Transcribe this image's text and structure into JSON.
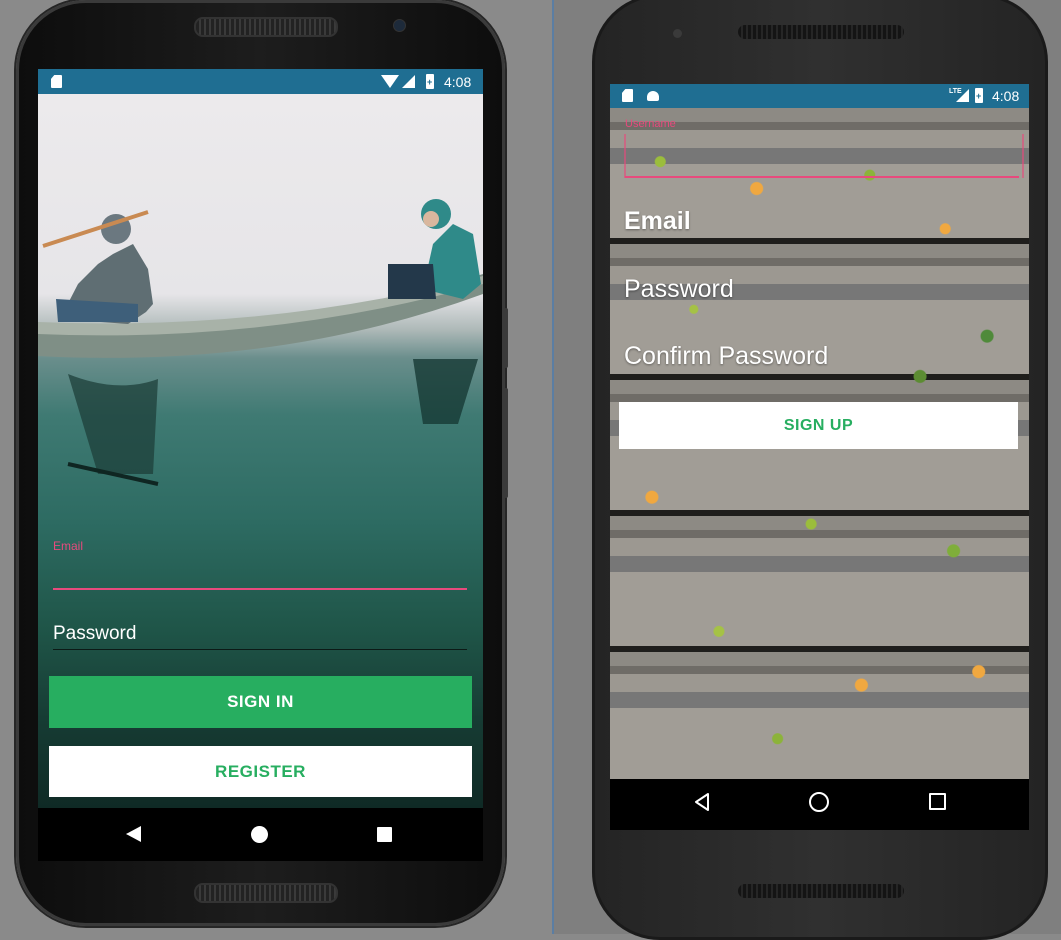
{
  "left_phone": {
    "status_bar": {
      "time": "4:08"
    },
    "email_label": "Email",
    "password_placeholder": "Password",
    "sign_in_label": "SIGN IN",
    "register_label": "REGISTER"
  },
  "right_phone": {
    "status_bar": {
      "time": "4:08",
      "network": "LTE"
    },
    "username_label": "Username",
    "email_placeholder": "Email",
    "password_placeholder": "Password",
    "confirm_password_placeholder": "Confirm Password",
    "sign_up_label": "SIGN UP"
  },
  "colors": {
    "status_bar": "#1f6e92",
    "accent_pink": "#e74a7d",
    "primary_green": "#27ae60",
    "white": "#ffffff"
  },
  "icons": [
    "sd-card-icon",
    "wifi-icon",
    "signal-icon",
    "battery-icon",
    "android-icon",
    "back-icon",
    "home-icon",
    "recents-icon"
  ]
}
